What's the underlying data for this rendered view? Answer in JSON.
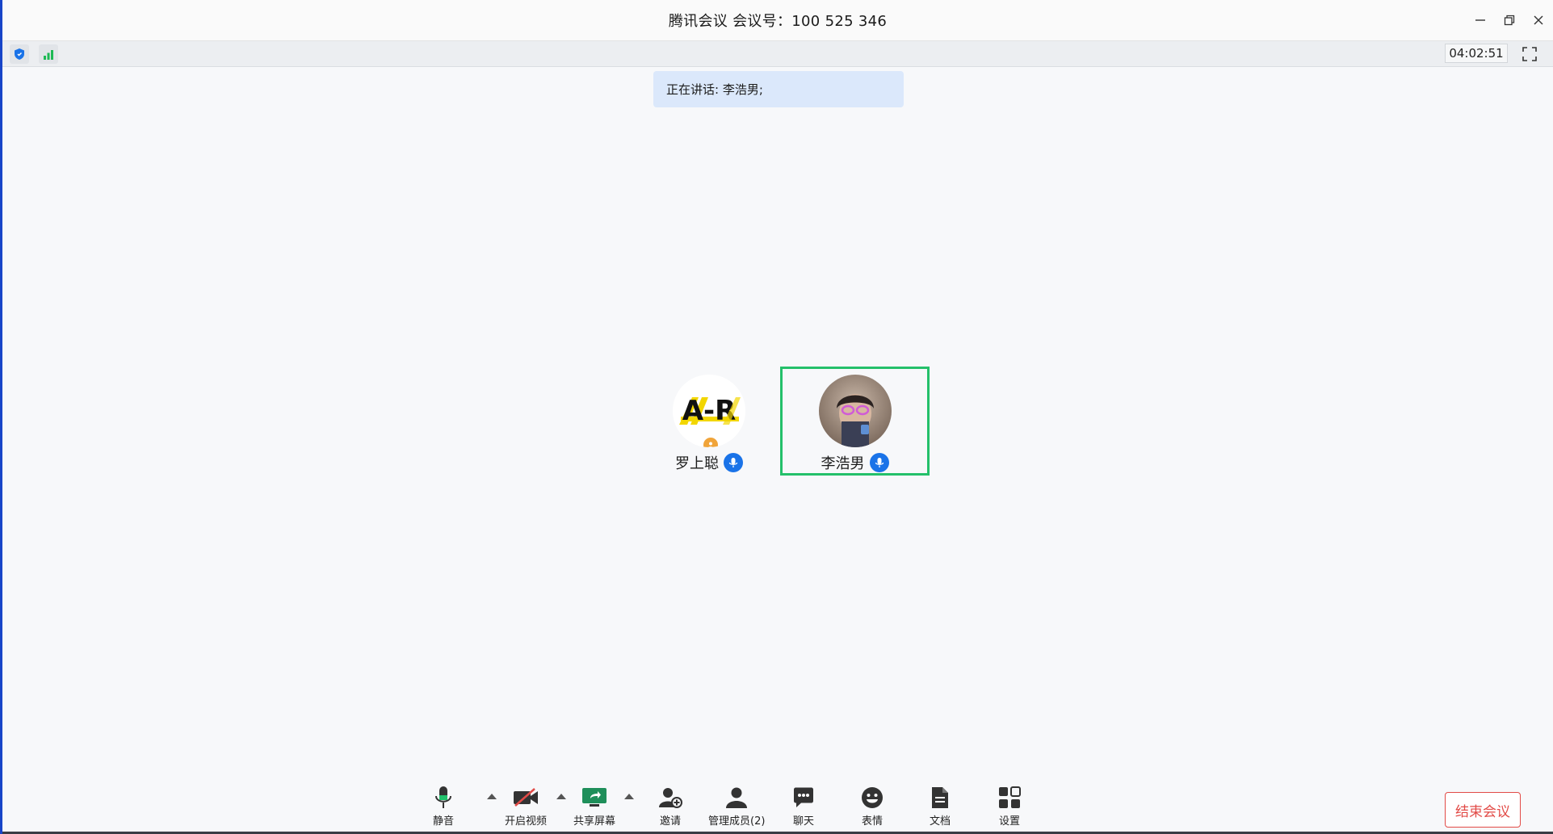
{
  "window": {
    "title": "腾讯会议 会议号：100 525 346",
    "controls": [
      "minimize-icon",
      "restore-icon",
      "close-icon"
    ]
  },
  "statusbar": {
    "timer": "04:02:51",
    "icons": [
      "shield-icon",
      "signal-icon",
      "fullscreen-icon"
    ]
  },
  "speaking": {
    "text": "正在讲话: 李浩男;"
  },
  "participants": [
    {
      "name": "罗上聪",
      "avatar": "AR-logo",
      "host": true,
      "mic": "on"
    },
    {
      "name": "李浩男",
      "avatar": "photo",
      "active_speaker": true,
      "mic": "on"
    }
  ],
  "toolbar": {
    "items": [
      {
        "label": "静音",
        "icon": "microphone-icon"
      },
      {
        "label": "开启视频",
        "icon": "video-off-icon"
      },
      {
        "label": "共享屏幕",
        "icon": "share-screen-icon"
      },
      {
        "label": "邀请",
        "icon": "invite-icon"
      },
      {
        "label": "管理成员(2)",
        "icon": "members-icon"
      },
      {
        "label": "聊天",
        "icon": "chat-icon"
      },
      {
        "label": "表情",
        "icon": "emoji-icon"
      },
      {
        "label": "文档",
        "icon": "document-icon"
      },
      {
        "label": "设置",
        "icon": "settings-icon"
      }
    ],
    "end_label": "结束会议"
  },
  "colors": {
    "accent_blue": "#1a73e8",
    "speaker_border": "#24c06a",
    "end_red": "#e24b47",
    "banner_bg": "#dbe8fb",
    "share_green": "#1f8f5a"
  }
}
